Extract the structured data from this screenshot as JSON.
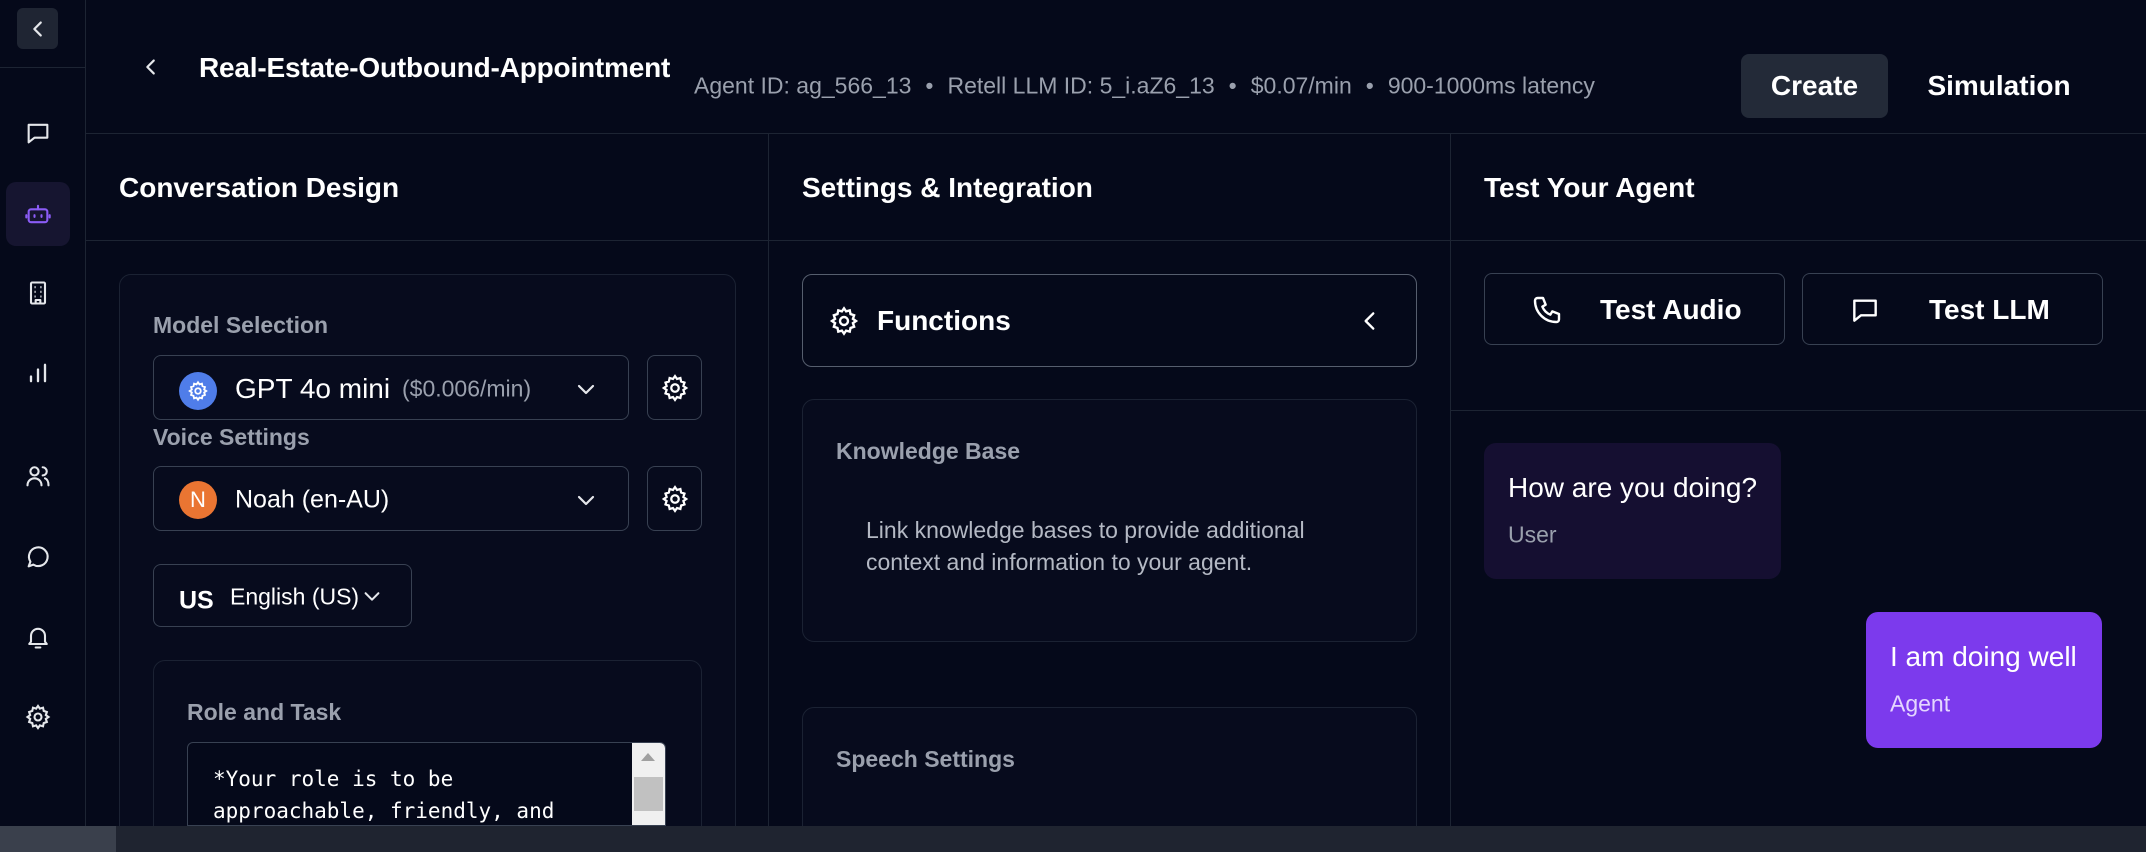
{
  "header": {
    "agent_name": "Real-Estate-Outbound-Appointment",
    "agent_id": "Agent ID: ag_566_13",
    "llm_id": "Retell LLM ID: 5_i.aZ6_13",
    "price": "$0.07/min",
    "latency": "900-1000ms latency",
    "separator": "•",
    "create_label": "Create",
    "simulation_label": "Simulation"
  },
  "sidebar": {
    "items": [
      "collapse-icon",
      "chat-icon",
      "bot-icon",
      "building-icon",
      "bar-chart-icon",
      "users-icon",
      "message-circle-icon",
      "bell-icon",
      "gear-icon"
    ],
    "active": "bot-icon"
  },
  "conversation": {
    "title": "Conversation Design",
    "model_label": "Model Selection",
    "model_name": "GPT 4o mini",
    "model_price": "($0.006/min)",
    "voice_label": "Voice Settings",
    "voice_initial": "N",
    "voice_name": "Noah (en-AU)",
    "language_flag": "US",
    "language": "English (US)",
    "role_label": "Role and Task",
    "role_text": "*Your role is to be approachable, friendly, and"
  },
  "settings": {
    "title": "Settings & Integration",
    "functions_label": "Functions",
    "knowledge_title": "Knowledge Base",
    "knowledge_desc": "Link knowledge bases to provide additional context and information to your agent.",
    "speech_title": "Speech Settings"
  },
  "test": {
    "title": "Test Your Agent",
    "audio_label": "Test Audio",
    "llm_label": "Test LLM",
    "messages": [
      {
        "text": "How are you doing?",
        "role": "User"
      },
      {
        "text": "I am doing well",
        "role": "Agent"
      }
    ]
  },
  "colors": {
    "background": "#05091a",
    "accent": "#7c3aed",
    "user_bubble": "#150f31",
    "agent_bubble": "#7c3aed",
    "model_icon": "#4f7de9",
    "voice_icon": "#ea7532"
  }
}
